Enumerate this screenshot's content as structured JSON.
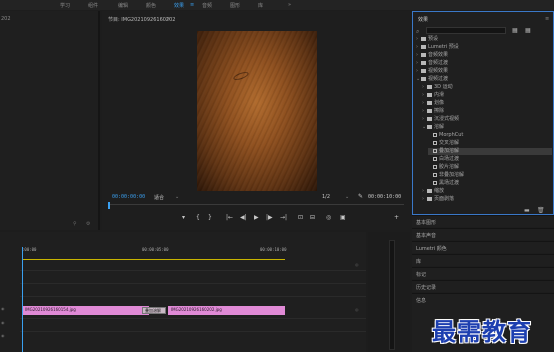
{
  "menu": {
    "tabs": [
      "学习",
      "组件",
      "编辑",
      "颜色",
      "效果",
      "音频",
      "图形",
      "库",
      "»"
    ],
    "active": "效果"
  },
  "left_panel": {
    "fragment": "202"
  },
  "program": {
    "title": "节目: IMG20210926160202",
    "menu_glyph": "≡",
    "timecode_current": "00:00:00:00",
    "fit_label": "适合",
    "quality": "1/2",
    "timecode_total": "00:00:10:00"
  },
  "transport": {
    "buttons": [
      "▾",
      "{",
      "}",
      "|←",
      "◀|",
      "▶",
      "|▶",
      "→|",
      "⊡",
      "⊟",
      "◎",
      "▣",
      "+"
    ]
  },
  "effects": {
    "title": "效果",
    "menu_glyph": "≡",
    "search_placeholder": "",
    "tree": [
      {
        "label": "预设",
        "type": "folder",
        "indent": 0,
        "arrow": "›"
      },
      {
        "label": "Lumetri 预设",
        "type": "folder",
        "indent": 0,
        "arrow": "›"
      },
      {
        "label": "音频效果",
        "type": "folder",
        "indent": 0,
        "arrow": "›"
      },
      {
        "label": "音频过渡",
        "type": "folder",
        "indent": 0,
        "arrow": "›"
      },
      {
        "label": "视频效果",
        "type": "folder",
        "indent": 0,
        "arrow": "›"
      },
      {
        "label": "视频过渡",
        "type": "folder",
        "indent": 0,
        "arrow": "⌄"
      },
      {
        "label": "3D 运动",
        "type": "folder",
        "indent": 1,
        "arrow": "›"
      },
      {
        "label": "内滑",
        "type": "folder",
        "indent": 1,
        "arrow": "›"
      },
      {
        "label": "划像",
        "type": "folder",
        "indent": 1,
        "arrow": "›"
      },
      {
        "label": "擦除",
        "type": "folder",
        "indent": 1,
        "arrow": "›"
      },
      {
        "label": "沉浸式视频",
        "type": "folder",
        "indent": 1,
        "arrow": "›"
      },
      {
        "label": "溶解",
        "type": "folder",
        "indent": 1,
        "arrow": "⌄"
      },
      {
        "label": "MorphCut",
        "type": "fx",
        "indent": 2,
        "arrow": ""
      },
      {
        "label": "交叉溶解",
        "type": "fx",
        "indent": 2,
        "arrow": ""
      },
      {
        "label": "叠加溶解",
        "type": "fx",
        "indent": 2,
        "arrow": "",
        "selected": true
      },
      {
        "label": "白场过渡",
        "type": "fx",
        "indent": 2,
        "arrow": ""
      },
      {
        "label": "胶片溶解",
        "type": "fx",
        "indent": 2,
        "arrow": ""
      },
      {
        "label": "非叠加溶解",
        "type": "fx",
        "indent": 2,
        "arrow": ""
      },
      {
        "label": "黑场过渡",
        "type": "fx",
        "indent": 2,
        "arrow": ""
      },
      {
        "label": "缩放",
        "type": "folder",
        "indent": 1,
        "arrow": "›"
      },
      {
        "label": "页面剥落",
        "type": "folder",
        "indent": 1,
        "arrow": "›"
      }
    ]
  },
  "right_panels": [
    "基本图形",
    "基本声音",
    "Lumetri 颜色",
    "库",
    "标记",
    "历史记录",
    "信息"
  ],
  "timeline": {
    "ruler_start": ":00:00",
    "ruler_mid": "00:00:05:00",
    "ruler_end": "00:00:10:00",
    "clip1": "IMG20210926160154.jpg",
    "clip2": "IMG20210926160202.jpg",
    "transition": "叠加溶解"
  },
  "watermark": "最需教育"
}
